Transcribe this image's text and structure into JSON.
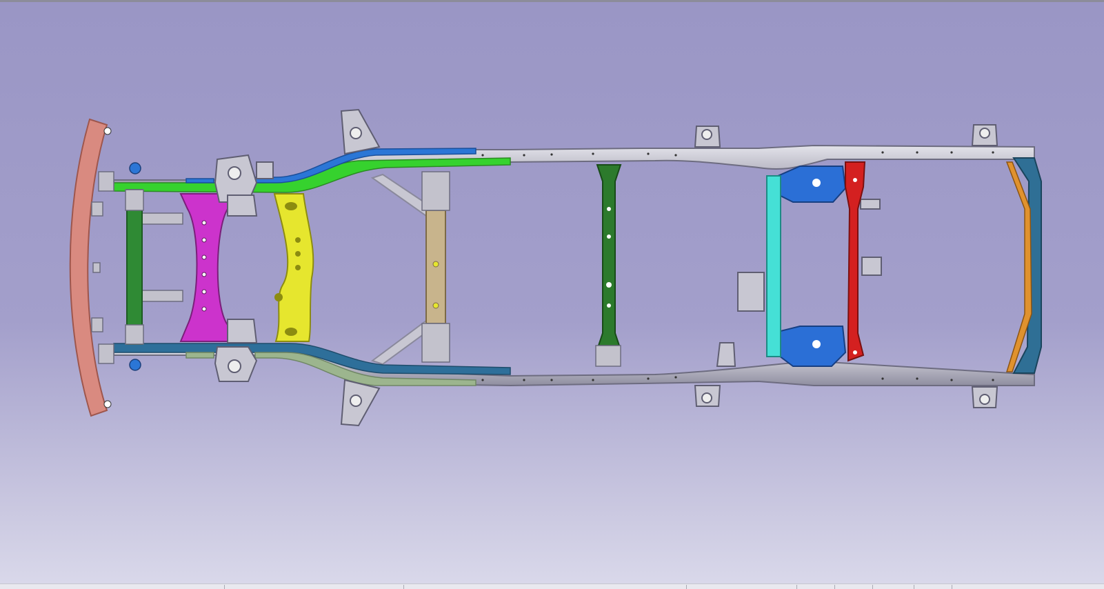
{
  "window": {
    "viewport_background": "#9e9ac8",
    "statusbar_background": "#e9e9ef"
  },
  "model": {
    "frame_color": "#c3c2cc",
    "parts": [
      {
        "name": "front-bumper-beam",
        "color": "#d98a80"
      },
      {
        "name": "front-crossmember",
        "color": "#2f8a34"
      },
      {
        "name": "engine-crossmember",
        "color": "#cc33cc"
      },
      {
        "name": "transmission-crossmember",
        "color": "#e6e62e"
      },
      {
        "name": "mid-crossmember",
        "color": "#c8b48c"
      },
      {
        "name": "center-crossmember",
        "color": "#2c7a2c"
      },
      {
        "name": "rear-crossmember-cyan",
        "color": "#45e0d6"
      },
      {
        "name": "rear-crossmember-red",
        "color": "#d42020"
      },
      {
        "name": "rear-spring-hangers",
        "color": "#2b6fd6"
      },
      {
        "name": "rear-bumper-beam",
        "color": "#2f6f95"
      },
      {
        "name": "rear-bumper-bracket",
        "color": "#e0922e"
      },
      {
        "name": "left-rail-front",
        "color": "#36d22e"
      },
      {
        "name": "left-rail-front-upper",
        "color": "#2b76d6"
      },
      {
        "name": "right-rail-front",
        "color": "#2e6f9a"
      },
      {
        "name": "right-rail-front-lower",
        "color": "#9cb58e"
      }
    ]
  }
}
